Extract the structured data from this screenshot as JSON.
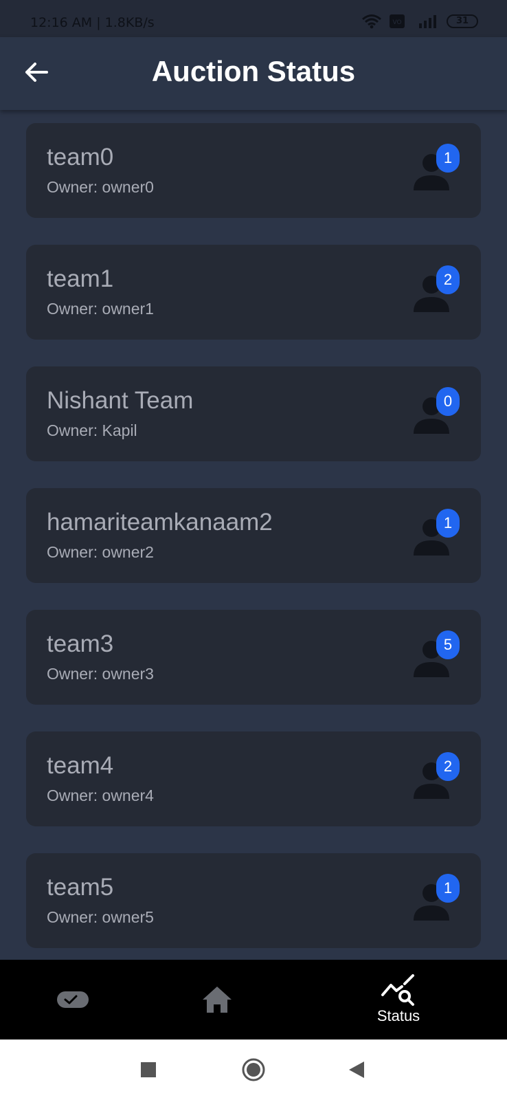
{
  "status_bar": {
    "time": "12:16 AM | 1.8KB/s",
    "battery": "31"
  },
  "app_bar": {
    "title": "Auction Status",
    "back_icon": "arrow-left-icon"
  },
  "teams": [
    {
      "name": "team0",
      "owner": "Owner: owner0",
      "count": "1"
    },
    {
      "name": "team1",
      "owner": "Owner: owner1",
      "count": "2"
    },
    {
      "name": "Nishant Team",
      "owner": "Owner: Kapil",
      "count": "0"
    },
    {
      "name": "hamariteamkanaam2",
      "owner": "Owner: owner2",
      "count": "1"
    },
    {
      "name": "team3",
      "owner": "Owner: owner3",
      "count": "5"
    },
    {
      "name": "team4",
      "owner": "Owner: owner4",
      "count": "2"
    },
    {
      "name": "team5",
      "owner": "Owner: owner5",
      "count": "1"
    }
  ],
  "bottom_nav": {
    "items": [
      {
        "icon": "toggle-icon",
        "label": ""
      },
      {
        "icon": "home-icon",
        "label": ""
      },
      {
        "icon": "status-chart-search-icon",
        "label": "Status"
      }
    ]
  },
  "colors": {
    "background": "#2c3548",
    "card": "#252a35",
    "badge": "#2166f0",
    "text_muted": "#a9acb6"
  }
}
